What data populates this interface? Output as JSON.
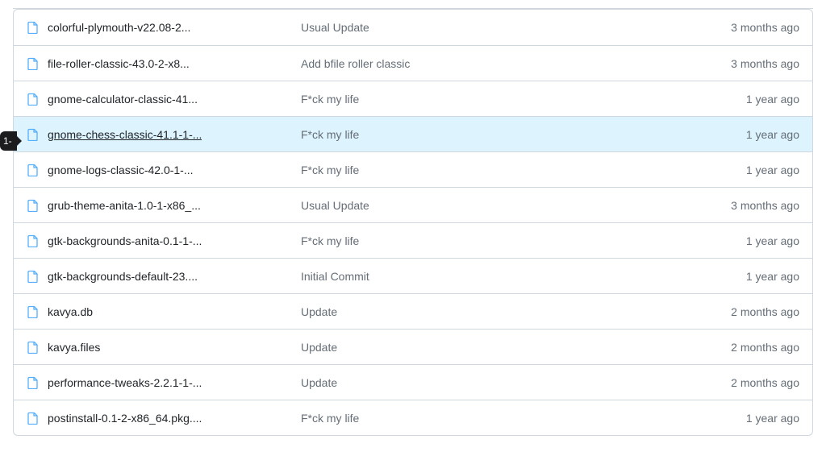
{
  "tooltip_fragment": "1-",
  "files": [
    {
      "name": "colorful-plymouth-v22.08-2...",
      "commit": "Usual Update",
      "age": "3 months ago",
      "highlighted": false
    },
    {
      "name": "file-roller-classic-43.0-2-x8...",
      "commit": "Add bfile roller classic",
      "age": "3 months ago",
      "highlighted": false
    },
    {
      "name": "gnome-calculator-classic-41...",
      "commit": "F*ck my life",
      "age": "1 year ago",
      "highlighted": false
    },
    {
      "name": "gnome-chess-classic-41.1-1-...",
      "commit": "F*ck my life",
      "age": "1 year ago",
      "highlighted": true
    },
    {
      "name": "gnome-logs-classic-42.0-1-...",
      "commit": "F*ck my life",
      "age": "1 year ago",
      "highlighted": false
    },
    {
      "name": "grub-theme-anita-1.0-1-x86_...",
      "commit": "Usual Update",
      "age": "3 months ago",
      "highlighted": false
    },
    {
      "name": "gtk-backgrounds-anita-0.1-1-...",
      "commit": "F*ck my life",
      "age": "1 year ago",
      "highlighted": false
    },
    {
      "name": "gtk-backgrounds-default-23....",
      "commit": "Initial Commit",
      "age": "1 year ago",
      "highlighted": false
    },
    {
      "name": "kavya.db",
      "commit": "Update",
      "age": "2 months ago",
      "highlighted": false
    },
    {
      "name": "kavya.files",
      "commit": "Update",
      "age": "2 months ago",
      "highlighted": false
    },
    {
      "name": "performance-tweaks-2.2.1-1-...",
      "commit": "Update",
      "age": "2 months ago",
      "highlighted": false
    },
    {
      "name": "postinstall-0.1-2-x86_64.pkg....",
      "commit": "F*ck my life",
      "age": "1 year ago",
      "highlighted": false
    }
  ]
}
